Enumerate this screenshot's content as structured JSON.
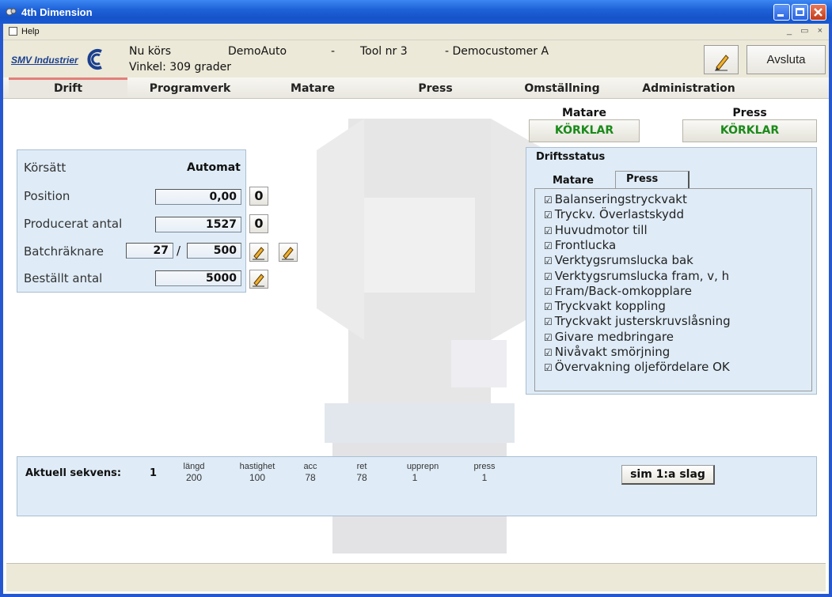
{
  "window": {
    "title": "4th Dimension"
  },
  "menu": {
    "help": "Help",
    "mdi_controls": "_ ▭ ×"
  },
  "header": {
    "logo_text": "SMV Industrier",
    "running_label": "Nu körs",
    "program": "DemoAuto",
    "sep1": "-",
    "tool": "Tool nr 3",
    "customer": "- Democustomer A",
    "angle": "Vinkel: 309 grader",
    "exit_label": "Avsluta"
  },
  "nav": {
    "tabs": [
      "Drift",
      "Programverk",
      "Matare",
      "Press",
      "Omställning",
      "Administration"
    ],
    "active": "Drift"
  },
  "status": {
    "matare_label": "Matare",
    "matare_value": "KÖRKLAR",
    "press_label": "Press",
    "press_value": "KÖRKLAR"
  },
  "left": {
    "korsatt_label": "Körsätt",
    "korsatt_value": "Automat",
    "position_label": "Position",
    "position_value": "0,00",
    "position_reset": "0",
    "producerat_label": "Producerat antal",
    "producerat_value": "1527",
    "producerat_reset": "0",
    "batch_label": "Batchräknare",
    "batch_current": "27",
    "batch_sep": "/",
    "batch_total": "500",
    "bestallt_label": "Beställt antal",
    "bestallt_value": "5000"
  },
  "drift": {
    "title": "Driftsstatus",
    "tabs": [
      "Matare",
      "Press"
    ],
    "active_tab": "Press",
    "items": [
      "Balanseringstryckvakt",
      "Tryckv. Överlastskydd",
      "Huvudmotor till",
      "Frontlucka",
      "Verktygsrumslucka bak",
      "Verktygsrumslucka fram, v, h",
      "Fram/Back-omkopplare",
      "Tryckvakt koppling",
      "Tryckvakt justerskruvslåsning",
      "Givare medbringare",
      "Nivåvakt smörjning",
      "Övervakning oljefördelare OK"
    ]
  },
  "sequence": {
    "label": "Aktuell sekvens:",
    "number": "1",
    "cols": [
      {
        "h": "längd",
        "v": "200"
      },
      {
        "h": "hastighet",
        "v": "100"
      },
      {
        "h": "acc",
        "v": "78"
      },
      {
        "h": "ret",
        "v": "78"
      },
      {
        "h": "upprepn",
        "v": "1"
      },
      {
        "h": "press",
        "v": "1"
      }
    ],
    "sim_button": "sim 1:a slag"
  },
  "colors": {
    "accent_green": "#1a8a1a",
    "panel_bg": "#dfecf7",
    "title_blue": "#1f62d8"
  },
  "icons": [
    "app-icon",
    "pencil-icon",
    "minimize-icon",
    "maximize-icon",
    "close-icon",
    "checkbox-checked-icon"
  ]
}
